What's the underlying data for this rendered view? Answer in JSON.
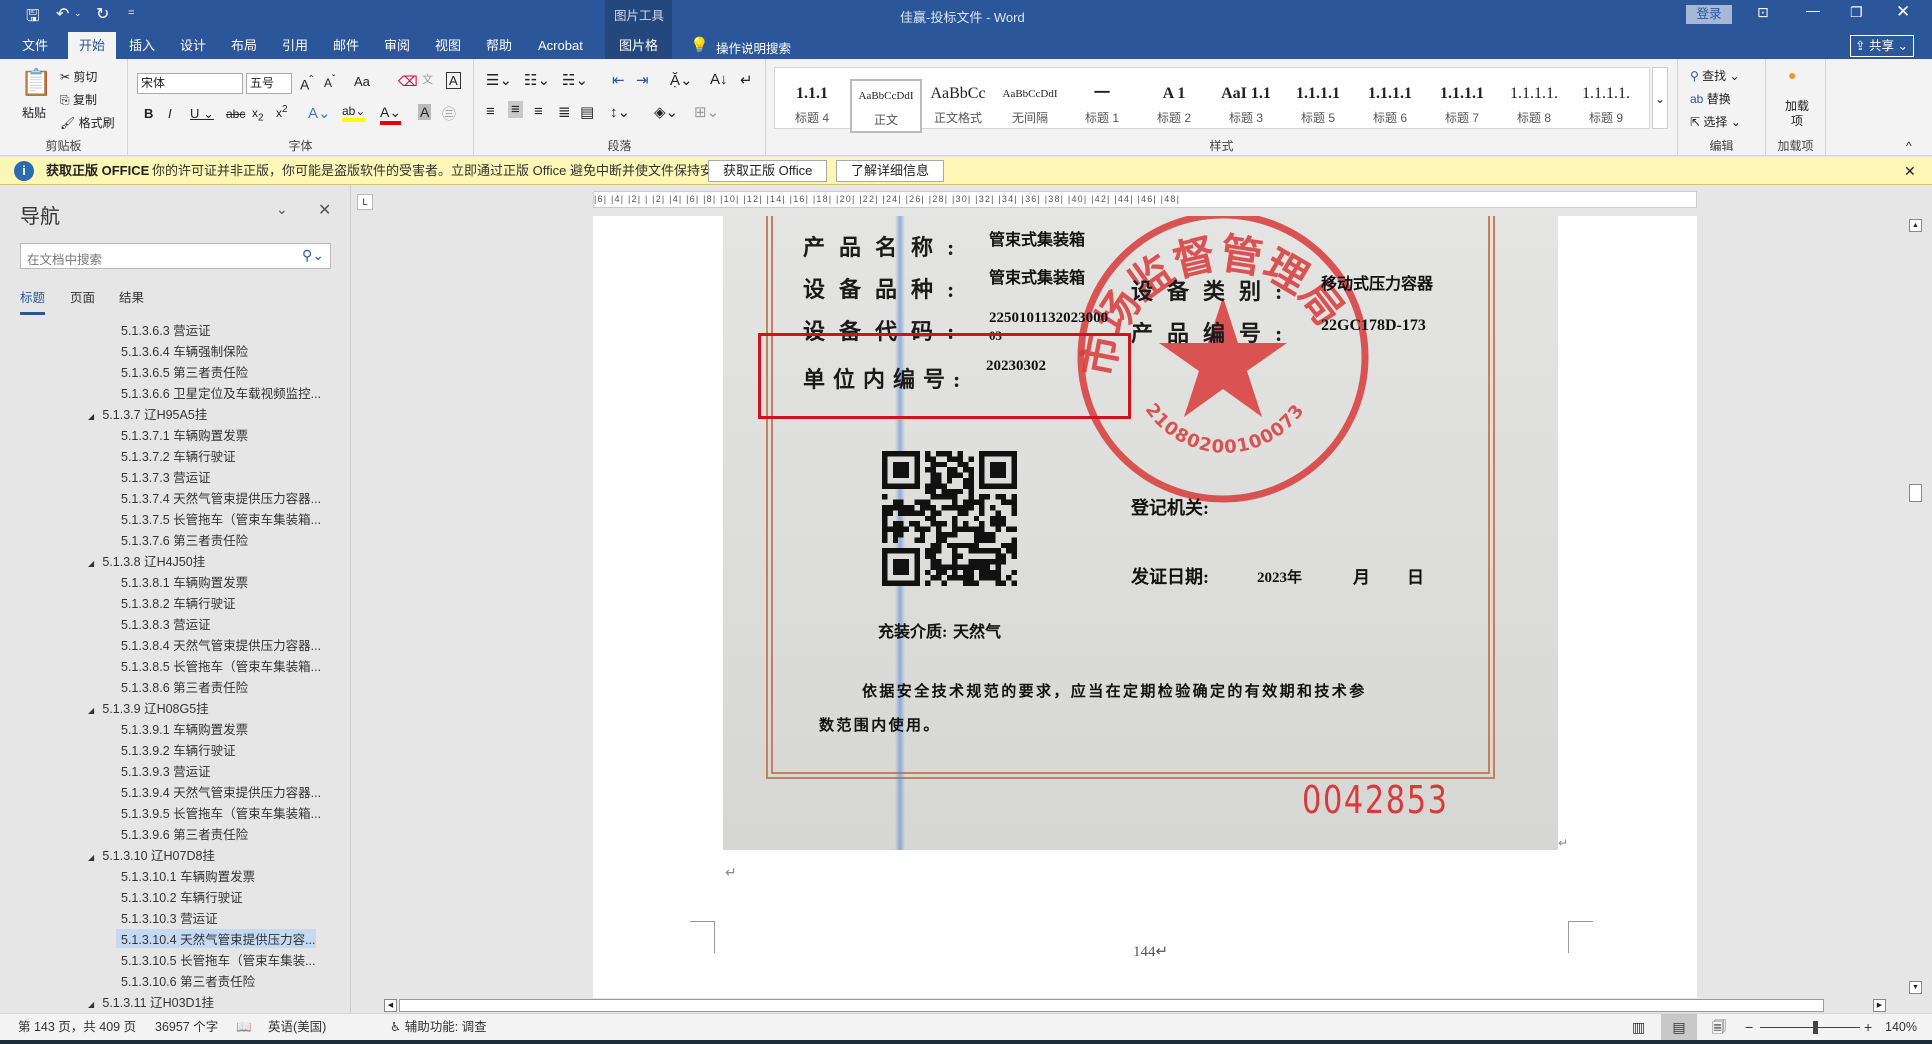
{
  "titlebar": {
    "document_title": "佳赢-投标文件 - Word",
    "context_tool": "图片工具",
    "login": "登录",
    "qat_more": "="
  },
  "tabs": [
    "文件",
    "开始",
    "插入",
    "设计",
    "布局",
    "引用",
    "邮件",
    "审阅",
    "视图",
    "帮助",
    "Acrobat",
    "图片格式"
  ],
  "tell_me": "操作说明搜索",
  "share": "共享",
  "ribbon": {
    "clipboard": {
      "paste": "粘贴",
      "cut": "剪切",
      "copy": "复制",
      "format_painter": "格式刷",
      "label": "剪贴板"
    },
    "font": {
      "font_name": "宋体",
      "font_size": "五号",
      "label": "字体",
      "change_case": "Aa"
    },
    "paragraph": {
      "label": "段落"
    },
    "styles": {
      "label": "样式",
      "items": [
        {
          "preview": "1.1.1",
          "name": "标题 4"
        },
        {
          "preview": "AaBbCcDdI",
          "name": "正文"
        },
        {
          "preview": "AaBbCc",
          "name": "正文格式"
        },
        {
          "preview": "AaBbCcDdI",
          "name": "无间隔"
        },
        {
          "preview": "一",
          "name": "标题 1"
        },
        {
          "preview": "A 1",
          "name": "标题 2"
        },
        {
          "preview": "AaI 1.1",
          "name": "标题 3"
        },
        {
          "preview": "1.1.1.1",
          "name": "标题 5"
        },
        {
          "preview": "1.1.1.1",
          "name": "标题 6"
        },
        {
          "preview": "1.1.1.1",
          "name": "标题 7"
        },
        {
          "preview": "1.1.1.1.",
          "name": "标题 8"
        },
        {
          "preview": "1.1.1.1.",
          "name": "标题 9"
        }
      ]
    },
    "editing": {
      "find": "查找",
      "replace": "替换",
      "select": "选择",
      "label": "编辑"
    },
    "addins": {
      "button": "加载项",
      "label": "加载项"
    }
  },
  "warning": {
    "title": "获取正版 OFFICE",
    "message": "你的许可证并非正版，你可能是盗版软件的受害者。立即通过正版 Office 避免中断并使文件保持安全。",
    "get_genuine": "获取正版 Office",
    "learn_more": "了解详细信息"
  },
  "nav": {
    "title": "导航",
    "search_placeholder": "在文档中搜索",
    "tabs": [
      "标题",
      "页面",
      "结果"
    ],
    "items": [
      {
        "level": 2,
        "text": "5.1.3.6.3 营运证"
      },
      {
        "level": 2,
        "text": "5.1.3.6.4 车辆强制保险"
      },
      {
        "level": 2,
        "text": "5.1.3.6.5 第三者责任险"
      },
      {
        "level": 2,
        "text": "5.1.3.6.6 卫星定位及车载视频监控..."
      },
      {
        "level": 1,
        "text": "5.1.3.7 辽H95A5挂"
      },
      {
        "level": 2,
        "text": "5.1.3.7.1 车辆购置发票"
      },
      {
        "level": 2,
        "text": "5.1.3.7.2 车辆行驶证"
      },
      {
        "level": 2,
        "text": "5.1.3.7.3 营运证"
      },
      {
        "level": 2,
        "text": "5.1.3.7.4 天然气管束提供压力容器..."
      },
      {
        "level": 2,
        "text": "5.1.3.7.5 长管拖车（管束车集装箱..."
      },
      {
        "level": 2,
        "text": "5.1.3.7.6 第三者责任险"
      },
      {
        "level": 1,
        "text": "5.1.3.8 辽H4J50挂"
      },
      {
        "level": 2,
        "text": "5.1.3.8.1 车辆购置发票"
      },
      {
        "level": 2,
        "text": "5.1.3.8.2 车辆行驶证"
      },
      {
        "level": 2,
        "text": "5.1.3.8.3 营运证"
      },
      {
        "level": 2,
        "text": "5.1.3.8.4 天然气管束提供压力容器..."
      },
      {
        "level": 2,
        "text": "5.1.3.8.5 长管拖车（管束车集装箱..."
      },
      {
        "level": 2,
        "text": "5.1.3.8.6 第三者责任险"
      },
      {
        "level": 1,
        "text": "5.1.3.9 辽H08G5挂"
      },
      {
        "level": 2,
        "text": "5.1.3.9.1 车辆购置发票"
      },
      {
        "level": 2,
        "text": "5.1.3.9.2 车辆行驶证"
      },
      {
        "level": 2,
        "text": "5.1.3.9.3 营运证"
      },
      {
        "level": 2,
        "text": "5.1.3.9.4 天然气管束提供压力容器..."
      },
      {
        "level": 2,
        "text": "5.1.3.9.5 长管拖车（管束车集装箱..."
      },
      {
        "level": 2,
        "text": "5.1.3.9.6 第三者责任险"
      },
      {
        "level": 1,
        "text": "5.1.3.10 辽H07D8挂"
      },
      {
        "level": 2,
        "text": "5.1.3.10.1 车辆购置发票"
      },
      {
        "level": 2,
        "text": "5.1.3.10.2 车辆行驶证"
      },
      {
        "level": 2,
        "text": "5.1.3.10.3 营运证"
      },
      {
        "level": 2,
        "text": "5.1.3.10.4 天然气管束提供压力容...",
        "selected": true
      },
      {
        "level": 2,
        "text": "5.1.3.10.5 长管拖车（管束车集装..."
      },
      {
        "level": 2,
        "text": "5.1.3.10.6 第三者责任险"
      },
      {
        "level": 1,
        "text": "5.1.3.11 辽H03D1挂"
      }
    ]
  },
  "ruler_text": "|6| |4| |2| |  |2| |4| |6| |8| |10| |12| |14| |16| |18| |20| |22| |24| |26| |28| |30| |32| |34| |36| |38| |40| |42| |44| |46| |48|",
  "certificate": {
    "product_name_label": "产品名称:",
    "product_name": "管束式集装箱",
    "equipment_variety_label": "设备品种:",
    "equipment_variety": "管束式集装箱",
    "equipment_category_label": "设备类别:",
    "equipment_category": "移动式压力容器",
    "equipment_code_label": "设备代码:",
    "equipment_code": "2250101132023000",
    "equipment_code_cont": "03",
    "product_number_label": "产品编号:",
    "product_number": "22GC178D-173",
    "unit_number_label": "单位内编号:",
    "unit_number": "20230302",
    "registration_authority_label": "登记机关:",
    "issue_date_label": "发证日期:",
    "issue_year": "2023年",
    "issue_month": "月",
    "issue_day": "日",
    "medium_label": "充装介质:",
    "medium": "天然气",
    "notice": "依据安全技术规范的要求，应当在定期检验确定的有效期和技术参",
    "notice_cont": "数范围内使用。",
    "serial": "0042853",
    "stamp_text": "市场监督管理局",
    "stamp_code": "210802001000733"
  },
  "page_number": "144",
  "status": {
    "page": "第 143 页，共 409 页",
    "words": "36957 个字",
    "language": "英语(美国)",
    "accessibility": "辅助功能: 调查",
    "zoom": "140%",
    "zoom_level": 0.55
  },
  "colors": {
    "brand": "#2b579a",
    "highlight_box": "#d0121b",
    "stamp": "#d83a3a"
  }
}
